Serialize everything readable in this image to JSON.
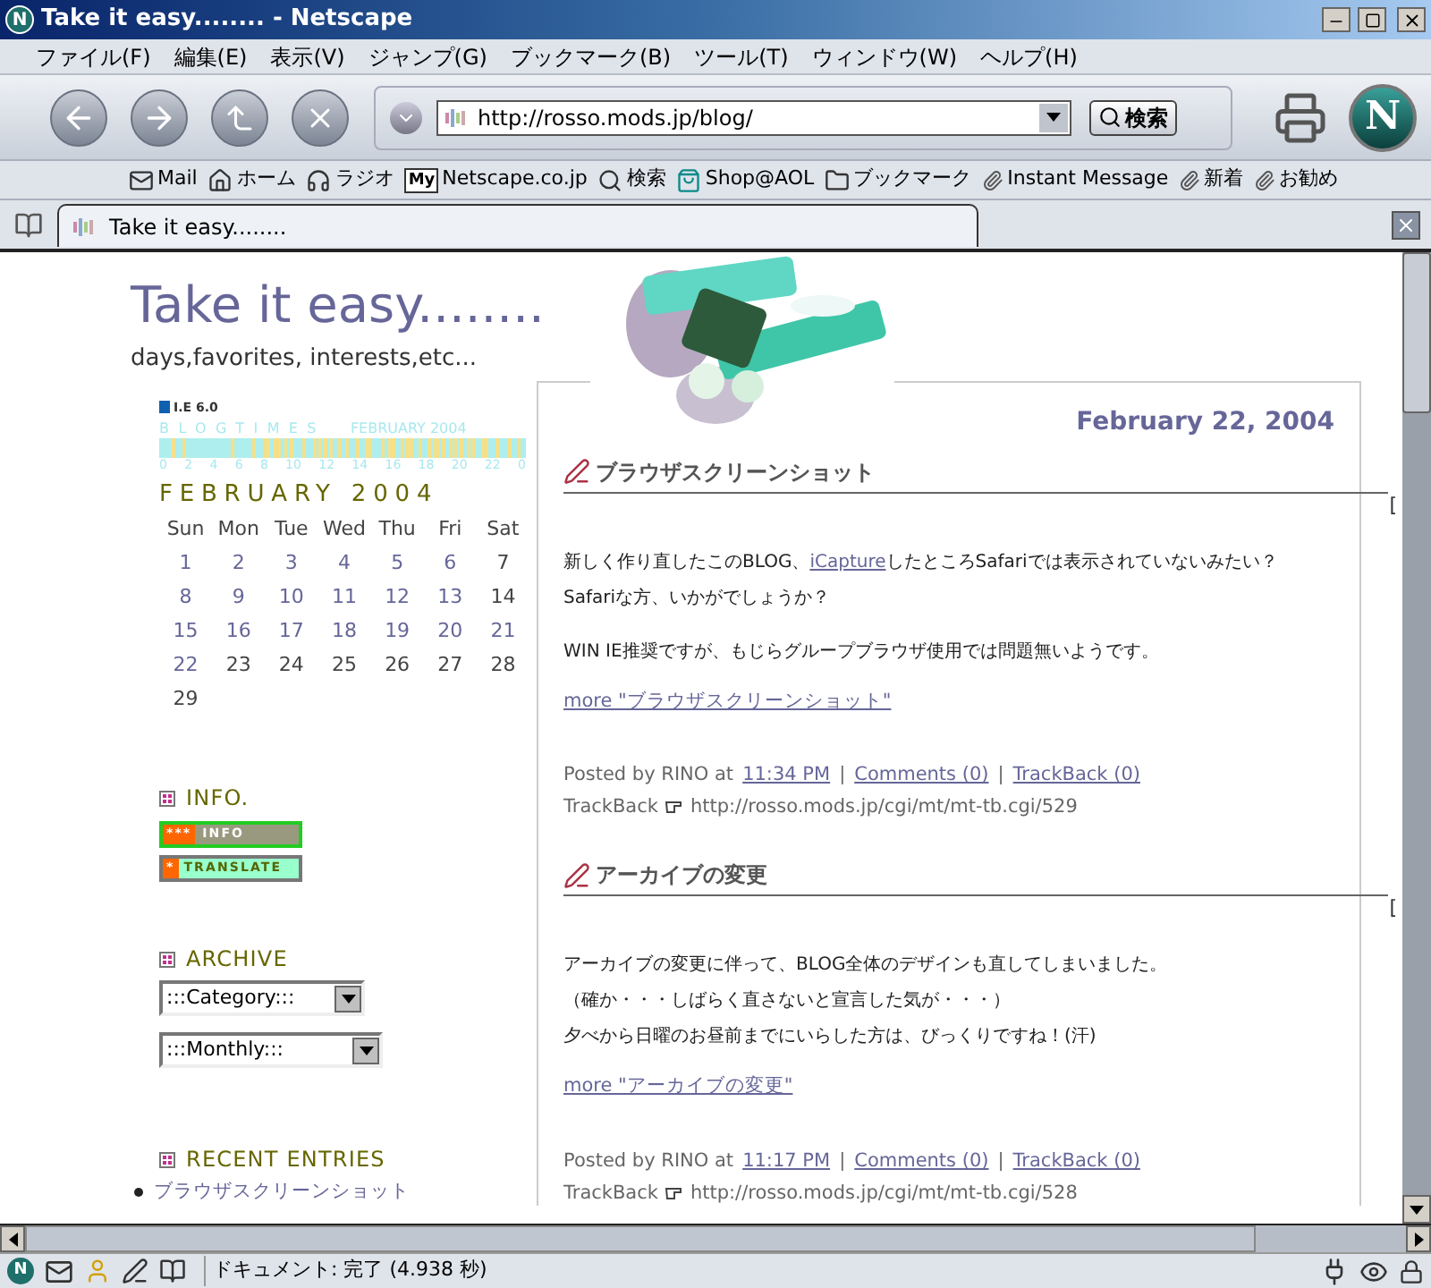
{
  "window": {
    "icon_letter": "N",
    "title": "Take it easy........ - Netscape"
  },
  "menu": [
    "ファイル(F)",
    "編集(E)",
    "表示(V)",
    "ジャンプ(G)",
    "ブックマーク(B)",
    "ツール(T)",
    "ウィンドウ(W)",
    "ヘルプ(H)"
  ],
  "nav": {
    "url": "http://rosso.mods.jp/blog/",
    "search_button": "検索",
    "logo_letter": "N"
  },
  "personal_toolbar": [
    {
      "kind": "mail",
      "label": "Mail"
    },
    {
      "kind": "home",
      "label": "ホーム"
    },
    {
      "kind": "radio",
      "label": "ラジオ"
    },
    {
      "kind": "my",
      "badge": "My",
      "label": "Netscape.co.jp"
    },
    {
      "kind": "search",
      "label": "検索"
    },
    {
      "kind": "shop",
      "label": "Shop@AOL"
    },
    {
      "kind": "folder",
      "label": "ブックマーク"
    },
    {
      "kind": "clip",
      "label": "Instant Message"
    },
    {
      "kind": "clip",
      "label": "新着"
    },
    {
      "kind": "clip",
      "label": "お勧め"
    }
  ],
  "tabs": [
    {
      "label": "Take it easy........",
      "selected": true
    }
  ],
  "page": {
    "title": "Take it easy........",
    "subtitle": "days,favorites, interests,etc...",
    "ie_badge": "I.E 6.0",
    "blogtimes": {
      "name": "BLOGTIMES",
      "month": "FEBRUARY 2004",
      "hours": [
        "0",
        "2",
        "4",
        "6",
        "8",
        "10",
        "12",
        "14",
        "16",
        "18",
        "20",
        "22",
        "0"
      ]
    },
    "calendar": {
      "month": "FEBRUARY 2004",
      "weekdays": [
        "Sun",
        "Mon",
        "Tue",
        "Wed",
        "Thu",
        "Fri",
        "Sat"
      ],
      "weeks": [
        [
          {
            "day": "1",
            "linked": true
          },
          {
            "day": "2",
            "linked": true
          },
          {
            "day": "3",
            "linked": true
          },
          {
            "day": "4",
            "linked": true
          },
          {
            "day": "5",
            "linked": true
          },
          {
            "day": "6",
            "linked": true
          },
          {
            "day": "7",
            "linked": false
          }
        ],
        [
          {
            "day": "8",
            "linked": true
          },
          {
            "day": "9",
            "linked": true
          },
          {
            "day": "10",
            "linked": true
          },
          {
            "day": "11",
            "linked": true
          },
          {
            "day": "12",
            "linked": true
          },
          {
            "day": "13",
            "linked": true
          },
          {
            "day": "14",
            "linked": false
          }
        ],
        [
          {
            "day": "15",
            "linked": true
          },
          {
            "day": "16",
            "linked": true
          },
          {
            "day": "17",
            "linked": true
          },
          {
            "day": "18",
            "linked": true
          },
          {
            "day": "19",
            "linked": true
          },
          {
            "day": "20",
            "linked": true
          },
          {
            "day": "21",
            "linked": true
          }
        ],
        [
          {
            "day": "22",
            "linked": true
          },
          {
            "day": "23",
            "linked": false
          },
          {
            "day": "24",
            "linked": false
          },
          {
            "day": "25",
            "linked": false
          },
          {
            "day": "26",
            "linked": false
          },
          {
            "day": "27",
            "linked": false
          },
          {
            "day": "28",
            "linked": false
          }
        ],
        [
          {
            "day": "29",
            "linked": false
          }
        ]
      ]
    },
    "info": {
      "heading": "INFO.",
      "buttons": [
        {
          "kind": "info",
          "stars": "***",
          "label": "INFO"
        },
        {
          "kind": "translate",
          "stars": "*",
          "label": "TRANSLATE"
        }
      ]
    },
    "archive": {
      "heading": "ARCHIVE",
      "selects": [
        ":::Category:::",
        ":::Monthly:::"
      ]
    },
    "recent": {
      "heading": "RECENT ENTRIES",
      "items": [
        "ブラウザスクリーンショット"
      ]
    },
    "date": "February 22, 2004",
    "posts": [
      {
        "title": "ブラウザスクリーンショット",
        "side": "[",
        "paragraphs": [
          {
            "lines": [
              [
                {
                  "kind": "text",
                  "text": "新しく作り直したこのBLOG、"
                },
                {
                  "kind": "link",
                  "text": "iCapture"
                },
                {
                  "kind": "text",
                  "text": "したところSafariでは表示されていないみたい？"
                }
              ],
              [
                {
                  "kind": "text",
                  "text": "Safariな方、いかがでしょうか？"
                }
              ]
            ]
          },
          {
            "lines": [
              [
                {
                  "kind": "text",
                  "text": "WIN IE推奨ですが、もじらグループブラウザ使用では問題無いようです。"
                }
              ]
            ]
          }
        ],
        "more": "more \"ブラウザスクリーンショット\"",
        "posted": "Posted by RINO at",
        "time": "11:34 PM",
        "separator_1": "|",
        "comments": "Comments (0)",
        "separator_2": "|",
        "trackback": "TrackBack (0)",
        "tb_label": "TrackBack",
        "tb_url": "http://rosso.mods.jp/cgi/mt/mt-tb.cgi/529"
      },
      {
        "title": "アーカイブの変更",
        "side": "[",
        "paragraphs": [
          {
            "lines": [
              [
                {
                  "kind": "text",
                  "text": "アーカイブの変更に伴って、BLOG全体のデザインも直してしまいました。"
                }
              ],
              [
                {
                  "kind": "text",
                  "text": "（確か・・・しばらく直さないと宣言した気が・・・）"
                }
              ],
              [
                {
                  "kind": "text",
                  "text": "夕べから日曜のお昼前までにいらした方は、びっくりですね！(汗)"
                }
              ]
            ]
          }
        ],
        "more": "more \"アーカイブの変更\"",
        "posted": "Posted by RINO at",
        "time": "11:17 PM",
        "separator_1": "|",
        "comments": "Comments (0)",
        "separator_2": "|",
        "trackback": "TrackBack (0)",
        "tb_label": "TrackBack",
        "tb_url": "http://rosso.mods.jp/cgi/mt/mt-tb.cgi/528"
      }
    ]
  },
  "status_bar": {
    "icon_letter": "N",
    "text": "ドキュメント: 完了 (4.938 秒)"
  }
}
